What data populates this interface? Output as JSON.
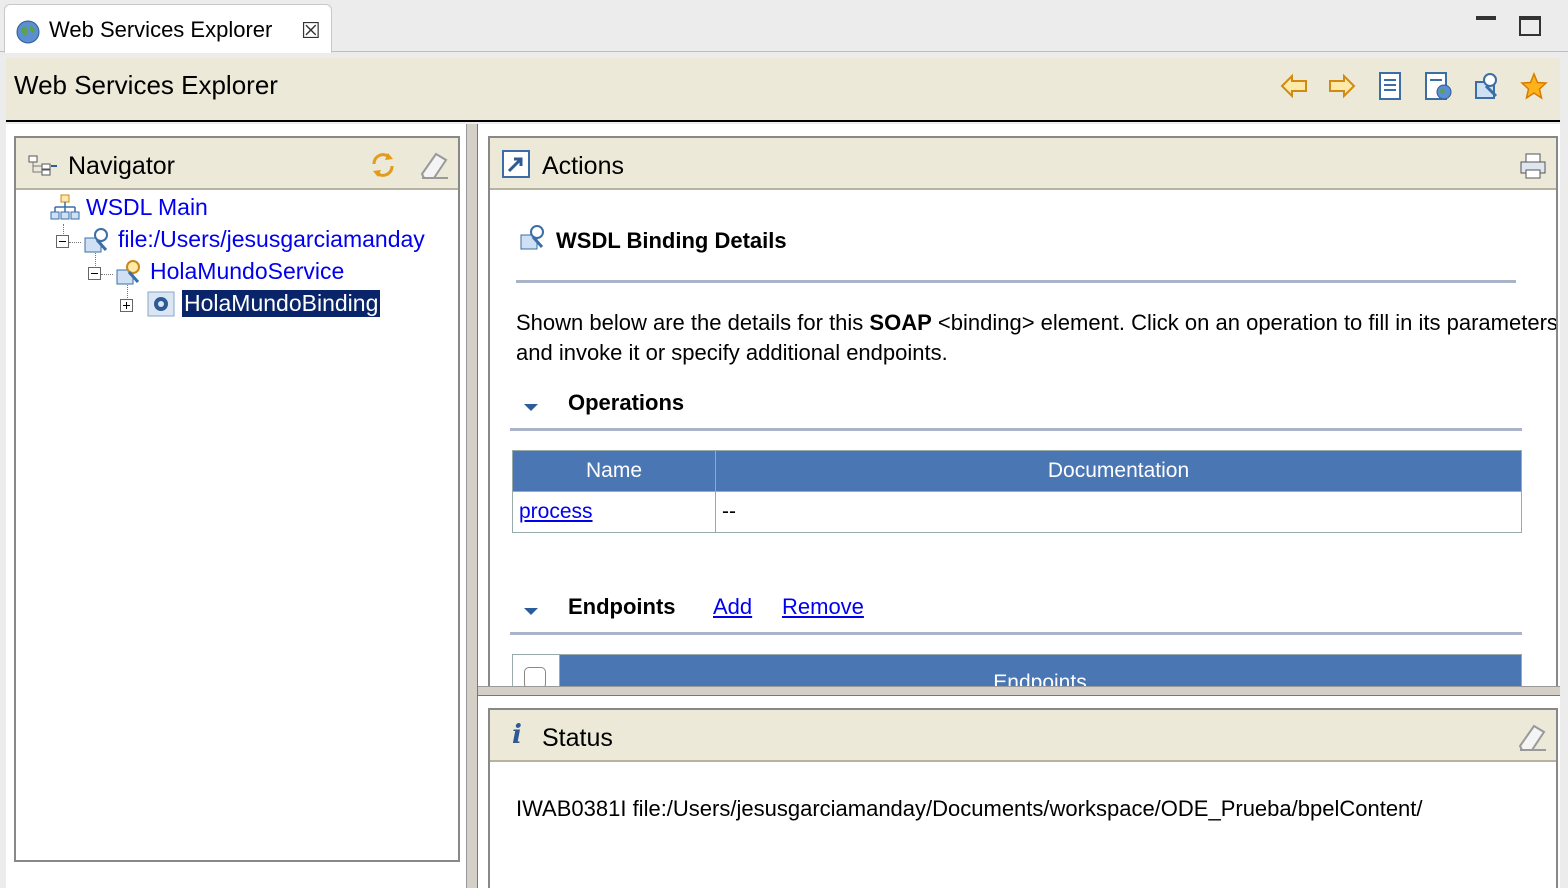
{
  "tab": {
    "title": "Web Services Explorer",
    "close_glyph": "☒"
  },
  "header": {
    "title": "Web Services Explorer",
    "toolbar": [
      "back-arrow-icon",
      "forward-arrow-icon",
      "uddi-page-icon",
      "wsil-page-icon",
      "wsdl-page-icon",
      "favorites-star-icon"
    ]
  },
  "navigator": {
    "title": "Navigator",
    "tree": [
      {
        "label": "WSDL Main",
        "level": 0
      },
      {
        "label": "file:/Users/jesusgarciamanday",
        "level": 1,
        "expanded": true
      },
      {
        "label": "HolaMundoService",
        "level": 2,
        "expanded": true
      },
      {
        "label": "HolaMundoBinding",
        "level": 3,
        "expanded": false,
        "selected": true
      }
    ]
  },
  "actions": {
    "title": "Actions",
    "heading": "WSDL Binding Details",
    "description_pre": "Shown below are the details for this ",
    "description_bold": "SOAP",
    "description_post": " <binding> element. Click on an operation to fill in its parameters and invoke it or specify additional endpoints.",
    "operations": {
      "title": "Operations",
      "columns": [
        "Name",
        "Documentation"
      ],
      "rows": [
        {
          "name": "process",
          "documentation": "--"
        }
      ]
    },
    "endpoints": {
      "title": "Endpoints",
      "add_label": "Add",
      "remove_label": "Remove",
      "column": "Endpoints"
    }
  },
  "status": {
    "title": "Status",
    "info_glyph": "i",
    "message": "IWAB0381I file:/Users/jesusgarciamanday/Documents/workspace/ODE_Prueba/bpelContent/"
  },
  "colors": {
    "link": "#0000ee",
    "table_header": "#4a76b3",
    "selection": "#0a246a",
    "header_band": "#ece9d8"
  }
}
